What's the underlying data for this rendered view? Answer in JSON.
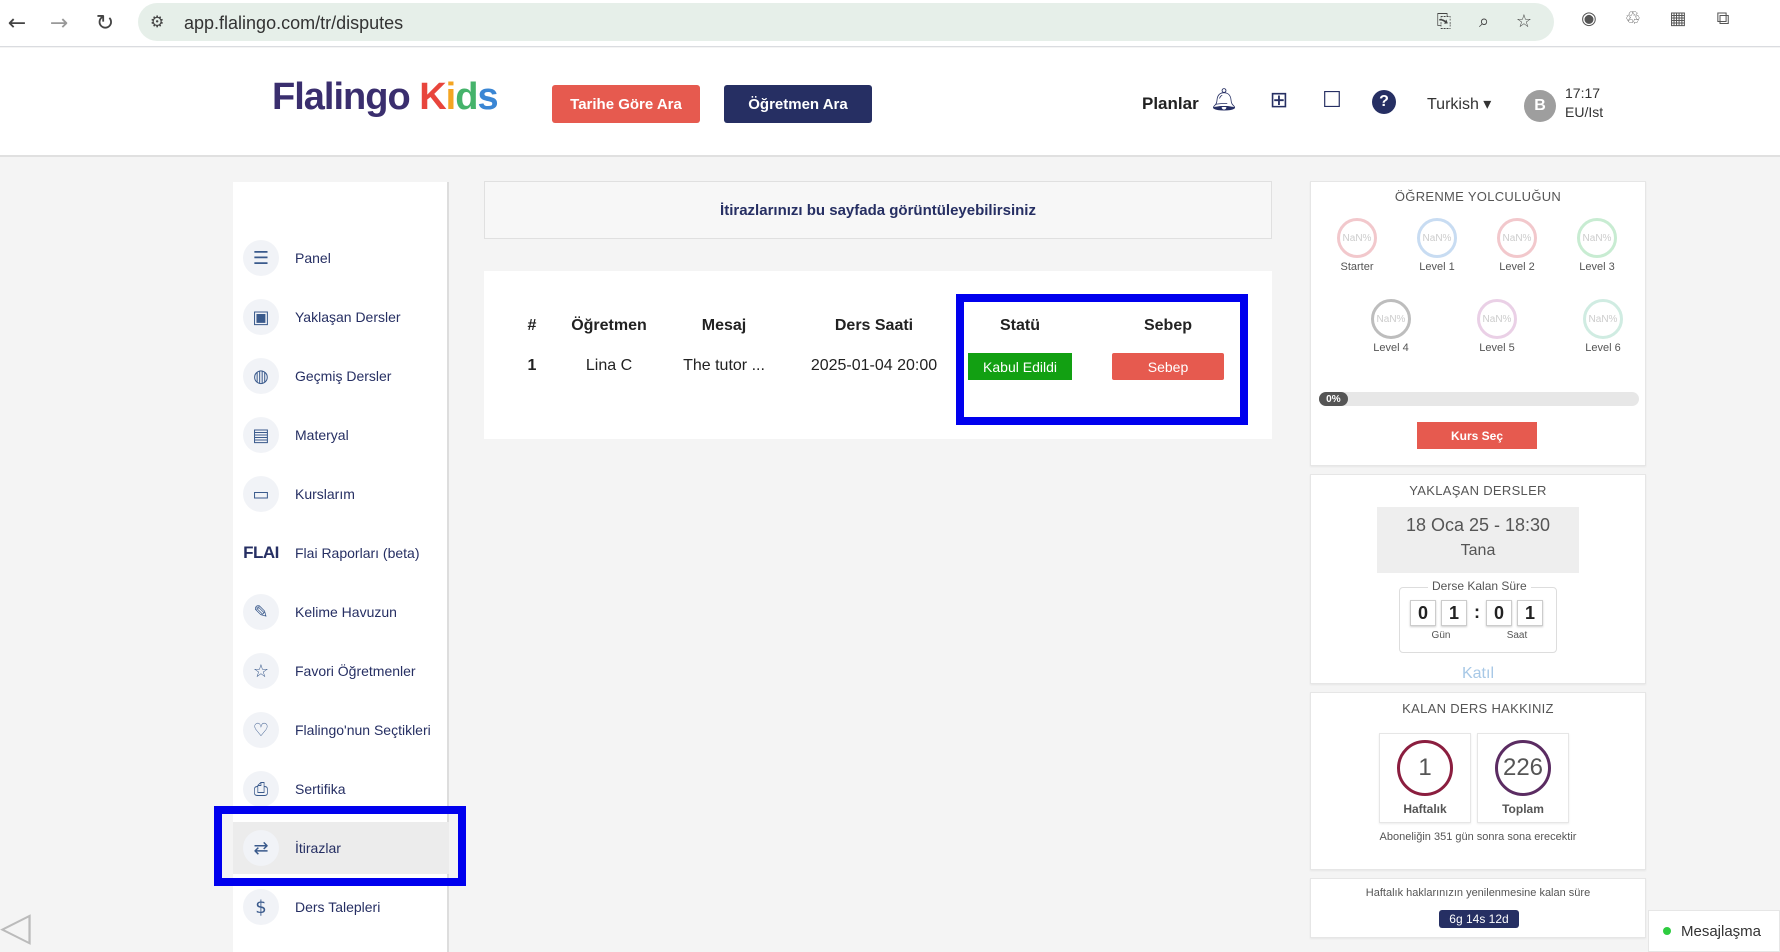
{
  "browser": {
    "url": "app.flalingo.com/tr/disputes",
    "icons": [
      "back-icon",
      "forward-icon",
      "reload-icon",
      "site-settings-icon",
      "install-icon",
      "zoom-icon",
      "bookmark-star-icon",
      "chrome-ext-icon",
      "recycle-ext-icon",
      "qr-code-icon",
      "extensions-puzzle-icon"
    ]
  },
  "header": {
    "logo_main": "Flalingo",
    "logo_kids": "Kids",
    "search_by_date": "Tarihe Göre Ara",
    "search_teacher": "Öğretmen Ara",
    "plans": "Planlar",
    "language": "Turkish",
    "avatar_initial": "B",
    "time": "17:17",
    "timezone": "EU/Ist"
  },
  "sidebar": {
    "items": [
      {
        "label": "Panel",
        "icon": "dashboard-icon"
      },
      {
        "label": "Yaklaşan Dersler",
        "icon": "upcoming-lessons-icon"
      },
      {
        "label": "Geçmiş Dersler",
        "icon": "globe-icon"
      },
      {
        "label": "Materyal",
        "icon": "document-icon"
      },
      {
        "label": "Kurslarım",
        "icon": "monitor-icon"
      },
      {
        "label": "Flai Raporları (beta)",
        "icon": "flai-logo-icon",
        "logo_text": "FLAI"
      },
      {
        "label": "Kelime Havuzun",
        "icon": "vocabulary-icon"
      },
      {
        "label": "Favori Öğretmenler",
        "icon": "star-bookmark-icon"
      },
      {
        "label": "Flalingo'nun Seçtikleri",
        "icon": "people-heart-icon"
      },
      {
        "label": "Sertifika",
        "icon": "certificate-icon"
      },
      {
        "label": "İtirazlar",
        "icon": "disputes-icon",
        "active": true
      },
      {
        "label": "Ders Talepleri",
        "icon": "money-request-icon"
      }
    ]
  },
  "main": {
    "notice": "İtirazlarınızı bu sayfada görüntüleyebilirsiniz",
    "table": {
      "headers": [
        "#",
        "Öğretmen",
        "Mesaj",
        "Ders Saati",
        "Statü",
        "Sebep"
      ],
      "rows": [
        {
          "num": "1",
          "teacher": "Lina C",
          "message": "The tutor ...",
          "lesson_time": "2025-01-04 20:00",
          "status": "Kabul Edildi",
          "reason": "Sebep"
        }
      ]
    }
  },
  "journey": {
    "title": "ÖĞRENME YOLCULUĞUN",
    "levels": [
      {
        "label": "Starter",
        "value": "NaN%",
        "color": "#f2c8cc"
      },
      {
        "label": "Level 1",
        "value": "NaN%",
        "color": "#c8dcf2"
      },
      {
        "label": "Level 2",
        "value": "NaN%",
        "color": "#f2c8cc"
      },
      {
        "label": "Level 3",
        "value": "NaN%",
        "color": "#c8ecd2"
      },
      {
        "label": "Level 4",
        "value": "NaN%",
        "color": "#bdbdbd"
      },
      {
        "label": "Level 5",
        "value": "NaN%",
        "color": "#ead0e6"
      },
      {
        "label": "Level 6",
        "value": "NaN%",
        "color": "#d0ece2"
      }
    ],
    "progress_label": "0%",
    "progress": 0,
    "course_button": "Kurs Seç"
  },
  "upcoming": {
    "title": "YAKLAŞAN DERSLER",
    "lesson_time": "18 Oca 25 - 18:30",
    "teacher": "Tana",
    "countdown_title": "Derse Kalan Süre",
    "digits": [
      "0",
      "1",
      "0",
      "1"
    ],
    "day_unit": "Gün",
    "hour_unit": "Saat",
    "join": "Katıl"
  },
  "remaining": {
    "title": "KALAN DERS HAKKINIZ",
    "weekly_value": "1",
    "weekly_label": "Haftalık",
    "total_value": "226",
    "total_label": "Toplam",
    "subscription_note": "Aboneliğin 351 gün sonra sona erecektir"
  },
  "renewal": {
    "title": "Haftalık haklarınızın yenilenmesine kalan süre",
    "badge": "6g 14s 12d"
  },
  "messaging": {
    "label": "Mesajlaşma"
  }
}
